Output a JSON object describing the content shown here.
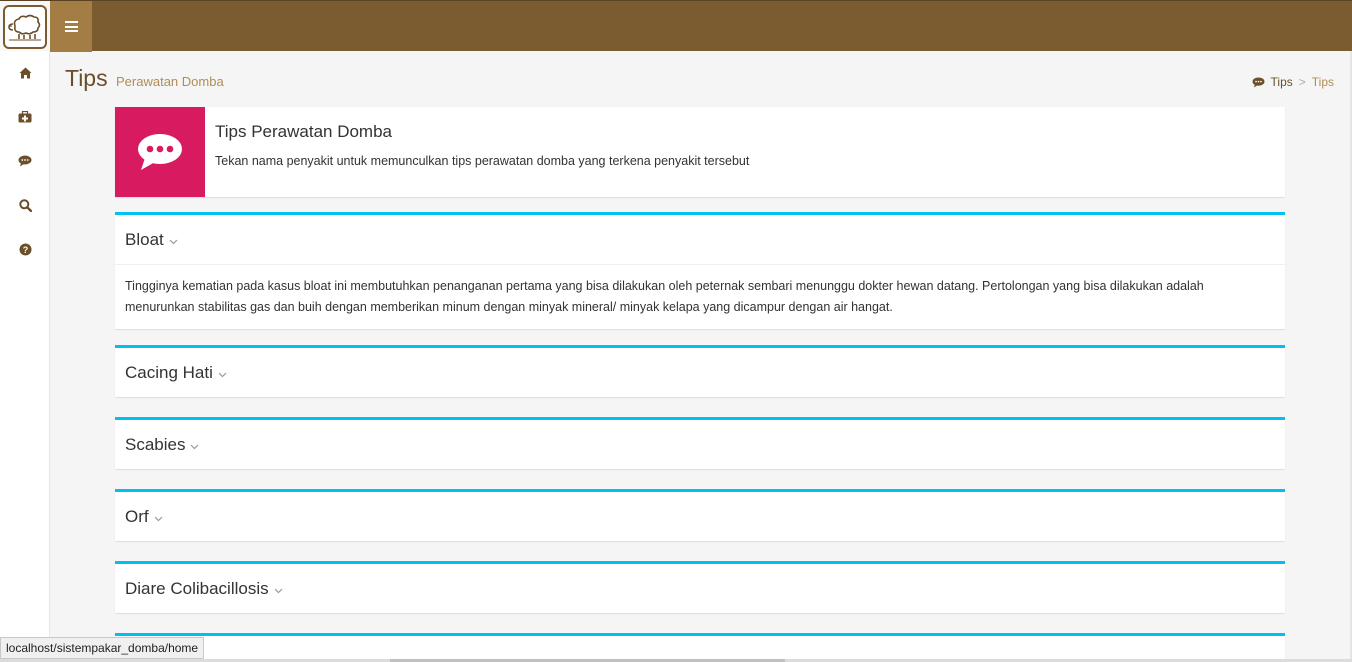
{
  "header": {
    "logo_icon": "sheep-logo-icon",
    "menu_icon": "hamburger-icon",
    "colors": {
      "topbar": "#7b5c31",
      "toggle": "#a47d44"
    }
  },
  "sidebar": {
    "items": [
      {
        "icon": "home-icon"
      },
      {
        "icon": "medkit-icon"
      },
      {
        "icon": "comment-icon"
      },
      {
        "icon": "search-icon"
      },
      {
        "icon": "question-circle-icon"
      }
    ]
  },
  "page": {
    "title": "Tips",
    "subtitle": "Perawatan Domba"
  },
  "breadcrumb": {
    "icon": "comment-icon",
    "items": [
      "Tips",
      "Tips"
    ],
    "separator": ">"
  },
  "info_box": {
    "icon": "comments-icon",
    "color": "#d81b60",
    "title": "Tips Perawatan Domba",
    "text": "Tekan nama penyakit untuk memunculkan tips perawatan domba yang terkena penyakit tersebut"
  },
  "diseases": [
    {
      "name": "Bloat",
      "expanded": true,
      "tip": "Tingginya kematian pada kasus bloat ini membutuhkan penanganan pertama yang bisa dilakukan oleh peternak sembari menunggu dokter hewan datang. Pertolongan yang bisa dilakukan adalah menurunkan stabilitas gas dan buih dengan memberikan minum dengan minyak mineral/ minyak kelapa yang dicampur dengan air hangat."
    },
    {
      "name": "Cacing Hati",
      "expanded": false
    },
    {
      "name": "Scabies",
      "expanded": false
    },
    {
      "name": "Orf",
      "expanded": false
    },
    {
      "name": "Diare Colibacillosis",
      "expanded": false
    }
  ],
  "accent_color": "#00c0ef",
  "status_bar": {
    "url": "localhost/sistempakar_domba/home"
  }
}
